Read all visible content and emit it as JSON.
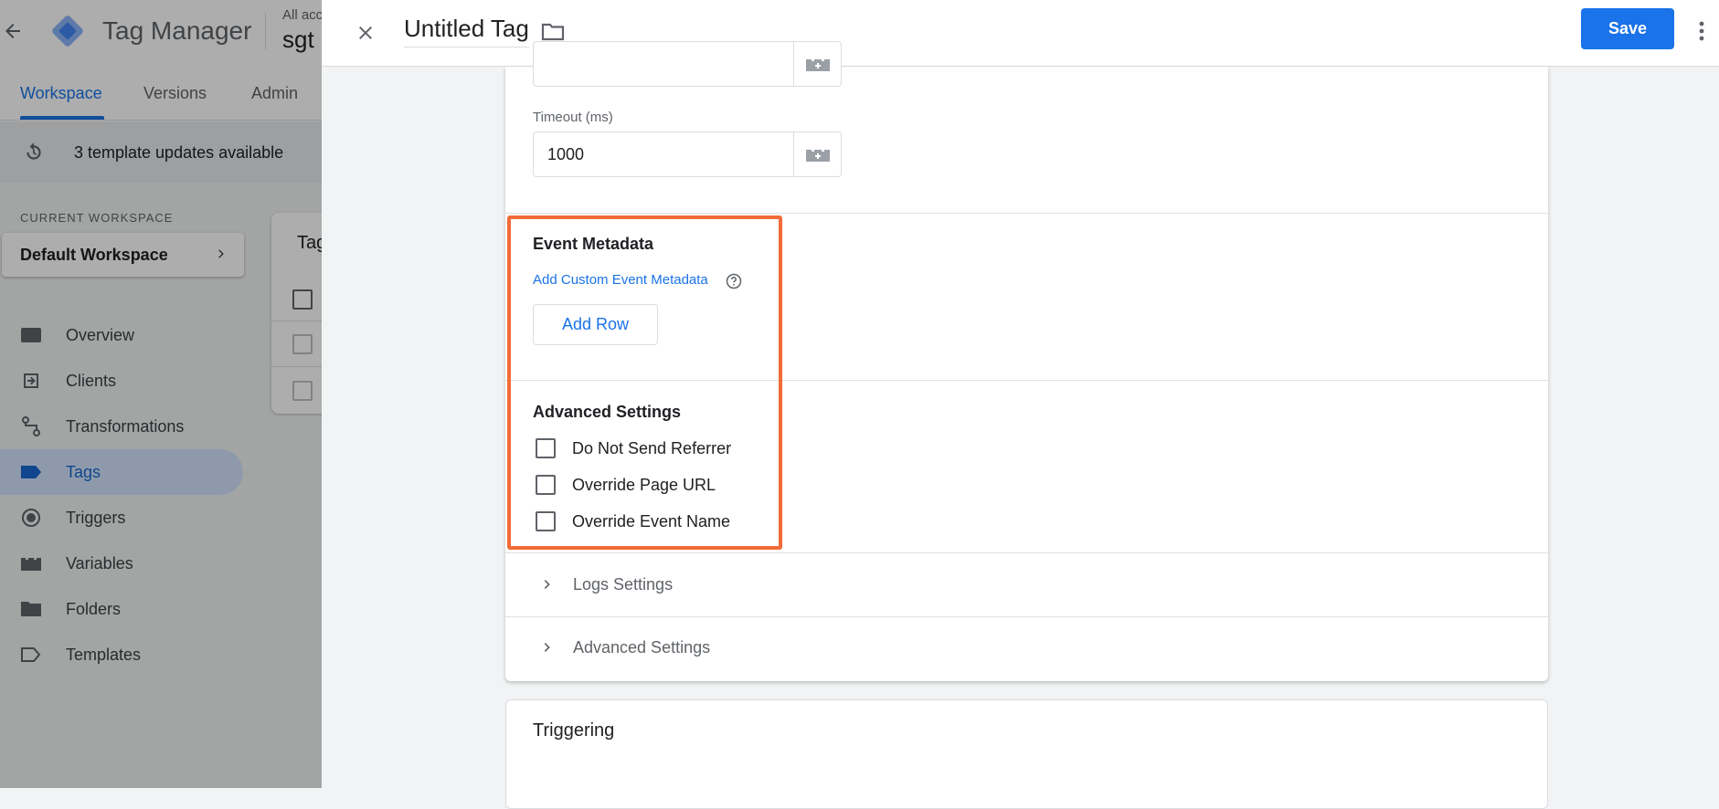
{
  "app": {
    "name": "Tag Manager",
    "account_label": "All acc",
    "container_name": "sgt"
  },
  "tabs": [
    {
      "label": "Workspace",
      "active": true
    },
    {
      "label": "Versions",
      "active": false
    },
    {
      "label": "Admin",
      "active": false
    }
  ],
  "updates_banner": "3 template updates available",
  "workspace": {
    "section_label": "CURRENT WORKSPACE",
    "name": "Default Workspace"
  },
  "sidebar": {
    "items": [
      {
        "label": "Overview",
        "icon": "overview-icon"
      },
      {
        "label": "Clients",
        "icon": "clients-icon"
      },
      {
        "label": "Transformations",
        "icon": "transformations-icon"
      },
      {
        "label": "Tags",
        "icon": "tag-icon",
        "active": true
      },
      {
        "label": "Triggers",
        "icon": "triggers-icon"
      },
      {
        "label": "Variables",
        "icon": "variables-icon"
      },
      {
        "label": "Folders",
        "icon": "folder-icon"
      },
      {
        "label": "Templates",
        "icon": "templates-icon"
      }
    ]
  },
  "tags_card_title": "Tag",
  "panel": {
    "title": "Untitled Tag",
    "save_label": "Save"
  },
  "config": {
    "timeout_label": "Timeout (ms)",
    "timeout_value": "1000",
    "event_metadata": {
      "title": "Event Metadata",
      "link": "Add Custom Event Metadata",
      "add_row_label": "Add Row"
    },
    "advanced": {
      "title": "Advanced Settings",
      "options": [
        {
          "label": "Do Not Send Referrer",
          "checked": false
        },
        {
          "label": "Override Page URL",
          "checked": false
        },
        {
          "label": "Override Event Name",
          "checked": false
        }
      ]
    },
    "collapsed_sections": [
      {
        "label": "Logs Settings"
      },
      {
        "label": "Advanced Settings"
      }
    ]
  },
  "triggering": {
    "title": "Triggering"
  },
  "colors": {
    "accent": "#1a73e8",
    "highlight": "#f26b38"
  }
}
